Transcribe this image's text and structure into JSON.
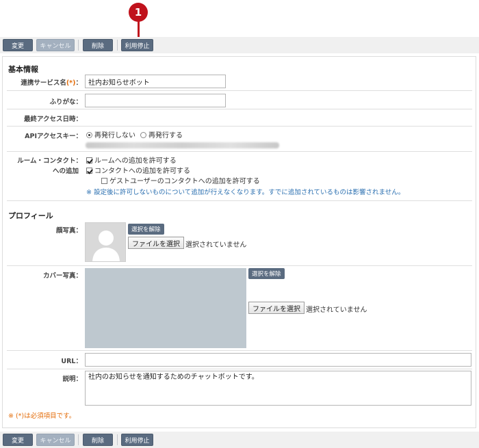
{
  "callout": {
    "number": "1"
  },
  "toolbar": {
    "change": "変更",
    "cancel": "キャンセル",
    "delete": "削除",
    "suspend": "利用停止"
  },
  "basic": {
    "title": "基本情報",
    "service_name_label": "連携サービス名",
    "required_mark": "(*)",
    "service_name_value": "社内お知らせボット",
    "furigana_label": "ふりがな：",
    "furigana_value": "",
    "last_access_label": "最終アクセス日時：",
    "api_key_label": "APIアクセスキー：",
    "api_opt_no": "再発行しない",
    "api_opt_yes": "再発行する",
    "room_label_1": "ルーム・コンタクト：",
    "room_label_2": "への追加",
    "allow_room": "ルームへの追加を許可する",
    "allow_contact": "コンタクトへの追加を許可する",
    "allow_guest": "ゲストユーザーのコンタクトへの追加を許可する",
    "note": "※ 設定後に許可しないものについて追加が行えなくなります。すでに追加されているものは影響されません。"
  },
  "profile": {
    "title": "プロフィール",
    "face_label": "顔写真：",
    "cover_label": "カバー写真：",
    "deselect": "選択を解除",
    "choose_file": "ファイルを選択",
    "no_file": "選択されていません",
    "url_label": "URL：",
    "url_value": "",
    "desc_label": "説明：",
    "desc_value": "社内のお知らせを通知するためのチャットボットです。"
  },
  "footer_note": "※ (*)は必須項目です。"
}
